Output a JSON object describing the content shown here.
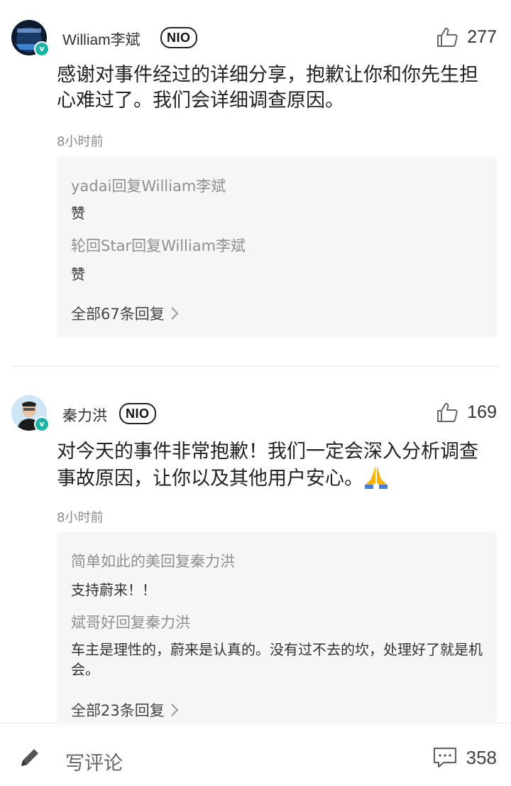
{
  "comments": [
    {
      "username": "William李斌",
      "badge": "NIO",
      "likes": "277",
      "text": "感谢对事件经过的详细分享，抱歉让你和你先生担心难过了。我们会详细调查原因。",
      "time": "8小时前",
      "replies": [
        {
          "head": "yadai回复William李斌",
          "body": "赞"
        },
        {
          "head": "轮回Star回复William李斌",
          "body": "赞"
        }
      ],
      "all_replies": "全部67条回复"
    },
    {
      "username": "秦力洪",
      "badge": "NIO",
      "likes": "169",
      "text": "对今天的事件非常抱歉！我们一定会深入分析调查事故原因，让你以及其他用户安心。",
      "emoji": "folded-hands-icon",
      "time": "8小时前",
      "replies": [
        {
          "head": "简单如此的美回复秦力洪",
          "body": "支持蔚来！！"
        },
        {
          "head": "斌哥好回复秦力洪",
          "body": "车主是理性的，蔚来是认真的。没有过不去的坎，处理好了就是机会。"
        }
      ],
      "all_replies": "全部23条回复"
    }
  ],
  "bottom_bar": {
    "write_placeholder": "写评论",
    "comment_count": "358"
  },
  "colors": {
    "verified_badge": "#1fb3a8",
    "reply_bg": "#f6f6f6",
    "muted_text": "#8f8f8f"
  }
}
